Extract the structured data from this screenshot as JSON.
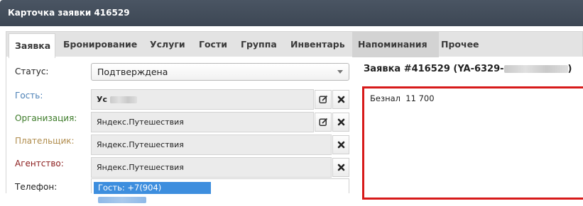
{
  "window": {
    "title": "Карточка заявки 416529"
  },
  "tabs": [
    {
      "label": "Заявка",
      "active": true
    },
    {
      "label": "Бронирование"
    },
    {
      "label": "Услуги"
    },
    {
      "label": "Гости"
    },
    {
      "label": "Группа"
    },
    {
      "label": "Инвентарь"
    },
    {
      "label": "Напоминания"
    },
    {
      "label": "Прочее"
    }
  ],
  "form": {
    "status_label": "Статус:",
    "status_value": "Подтверждена",
    "guest_label": "Гость:",
    "guest_value": "Ус",
    "organization_label": "Организация:",
    "organization_value": "Яндекс.Путешествия",
    "payer_label": "Плательщик:",
    "payer_value": "Яндекс.Путешествия",
    "agency_label": "Агентство:",
    "agency_value": "Яндекс.Путешествия",
    "phone_label": "Телефон:",
    "phone_value": "Гость: +7(904)"
  },
  "order": {
    "heading": "Заявка #416529 (YA-6329-",
    "heading_suffix": ")",
    "note": "Безнал  11 700"
  },
  "colors": {
    "guest_label": "#4a7fb5",
    "organization_label": "#3b7a27",
    "payer_label": "#b08c4c",
    "agency_label": "#8a1a1a",
    "note_border": "#d71a1a",
    "phone_chip": "#3d8ede"
  }
}
